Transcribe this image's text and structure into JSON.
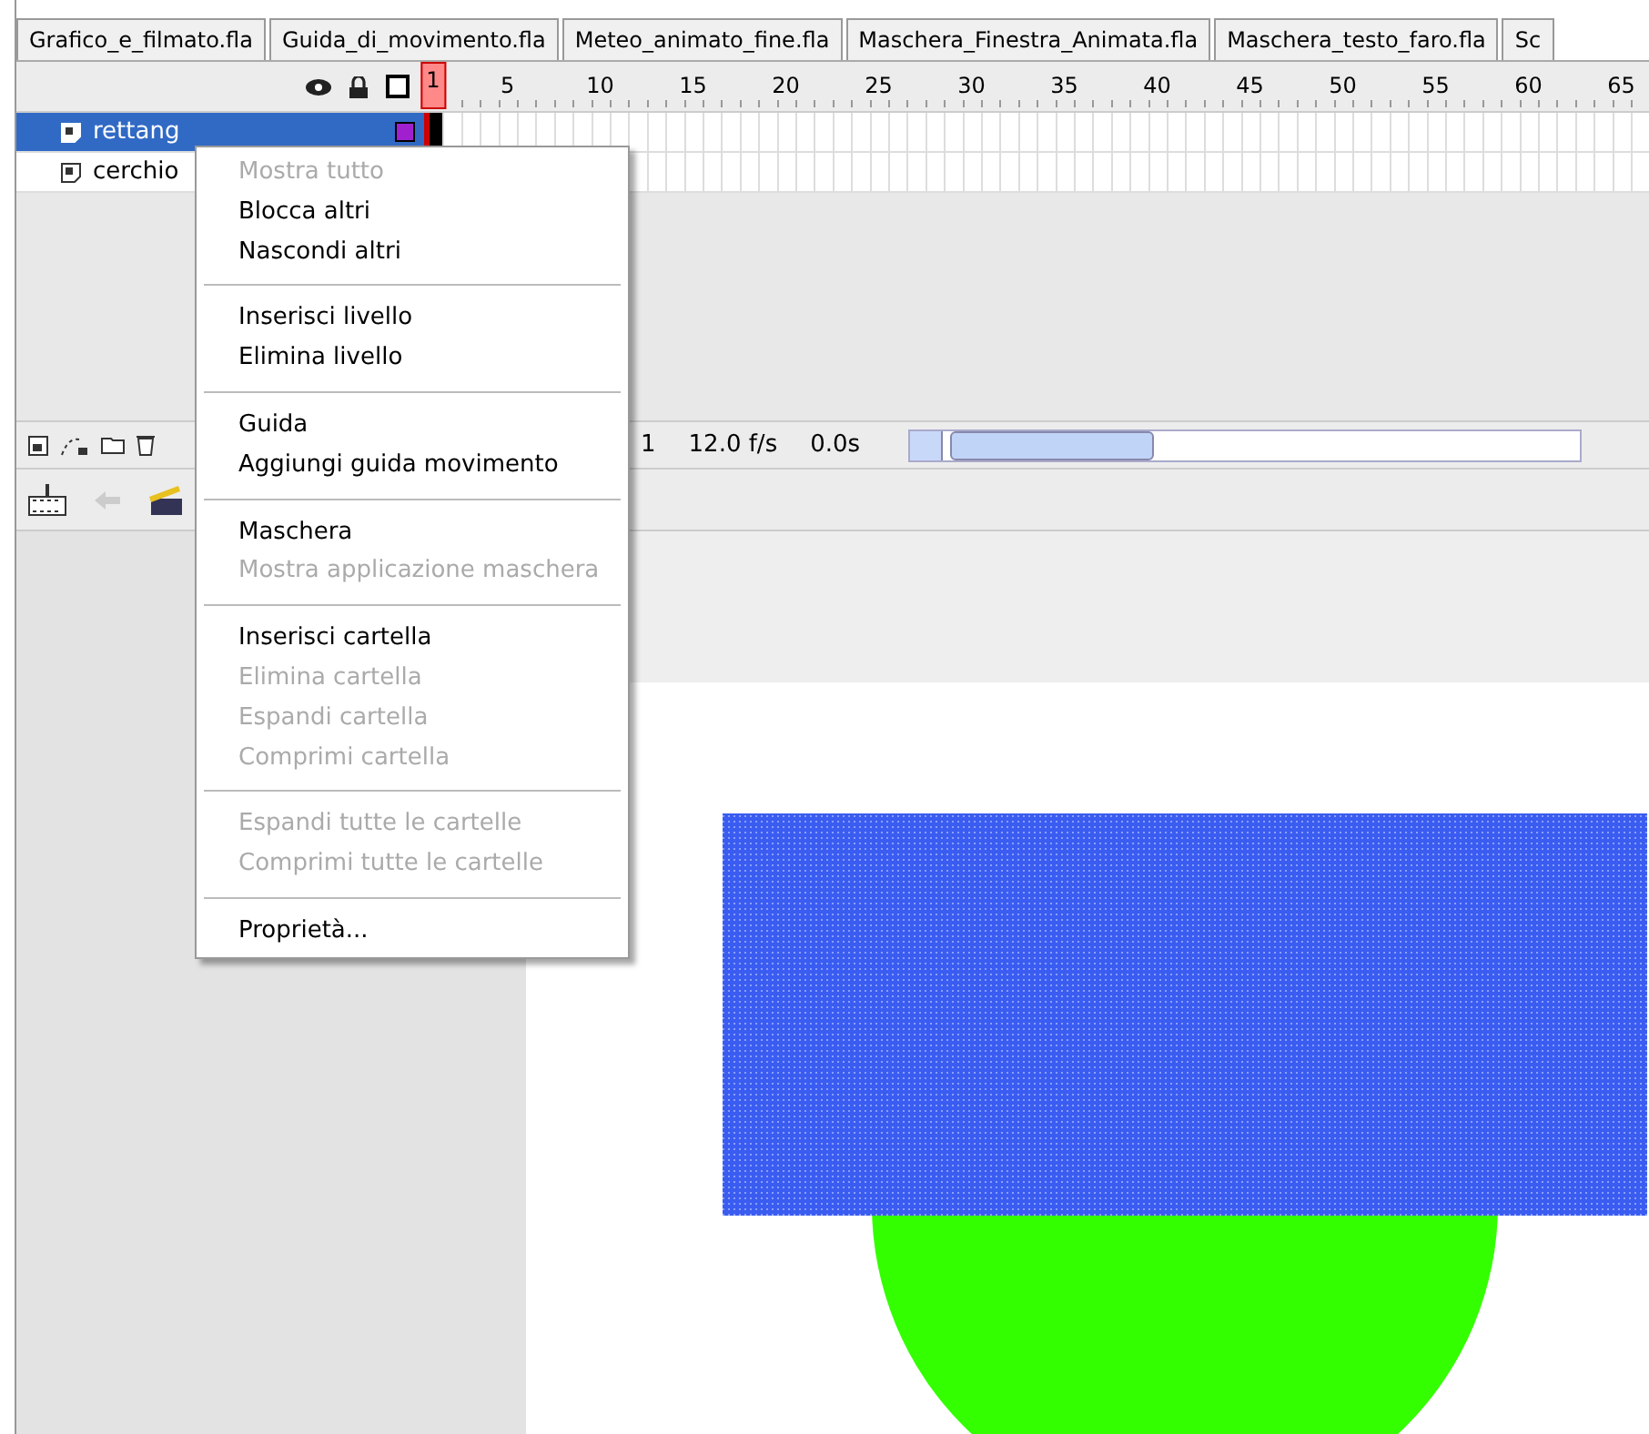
{
  "tabs": [
    {
      "label": "Grafico_e_filmato.fla",
      "selected": false
    },
    {
      "label": "Guida_di_movimento.fla",
      "selected": false
    },
    {
      "label": "Meteo_animato_fine.fla",
      "selected": false
    },
    {
      "label": "Maschera_Finestra_Animata.fla",
      "selected": false
    },
    {
      "label": "Maschera_testo_faro.fla",
      "selected": false
    },
    {
      "label": "Sc",
      "selected": false
    }
  ],
  "timeline": {
    "frames": [
      {
        "label": "1",
        "selected": true
      },
      {
        "label": "5",
        "selected": false
      },
      {
        "label": "10",
        "selected": false
      },
      {
        "label": "15",
        "selected": false
      },
      {
        "label": "20",
        "selected": false
      },
      {
        "label": "25",
        "selected": false
      },
      {
        "label": "30",
        "selected": false
      },
      {
        "label": "35",
        "selected": false
      },
      {
        "label": "40",
        "selected": false
      },
      {
        "label": "45",
        "selected": false
      },
      {
        "label": "50",
        "selected": false
      },
      {
        "label": "55",
        "selected": false
      },
      {
        "label": "60",
        "selected": false
      },
      {
        "label": "65",
        "selected": false
      }
    ],
    "layers": [
      {
        "name": "rettang",
        "selected": true,
        "color": "#a020d0"
      },
      {
        "name": "cerchio",
        "selected": false
      }
    ],
    "status": {
      "frame": "1",
      "rate": "12.0 f/s",
      "time": "0.0s"
    }
  },
  "context_menu": [
    {
      "kind": "item",
      "label": "Mostra tutto",
      "disabled": true
    },
    {
      "kind": "item",
      "label": "Blocca altri",
      "disabled": false
    },
    {
      "kind": "item",
      "label": "Nascondi altri",
      "disabled": false
    },
    {
      "kind": "separator"
    },
    {
      "kind": "item",
      "label": "Inserisci livello",
      "disabled": false
    },
    {
      "kind": "item",
      "label": "Elimina livello",
      "disabled": false
    },
    {
      "kind": "separator"
    },
    {
      "kind": "item",
      "label": "Guida",
      "disabled": false
    },
    {
      "kind": "item",
      "label": "Aggiungi guida movimento",
      "disabled": false
    },
    {
      "kind": "separator"
    },
    {
      "kind": "item",
      "label": "Maschera",
      "disabled": false
    },
    {
      "kind": "item",
      "label": "Mostra applicazione maschera",
      "disabled": true
    },
    {
      "kind": "separator"
    },
    {
      "kind": "item",
      "label": "Inserisci cartella",
      "disabled": false
    },
    {
      "kind": "item",
      "label": "Elimina cartella",
      "disabled": true
    },
    {
      "kind": "item",
      "label": "Espandi cartella",
      "disabled": true
    },
    {
      "kind": "item",
      "label": "Comprimi cartella",
      "disabled": true
    },
    {
      "kind": "separator"
    },
    {
      "kind": "item",
      "label": "Espandi tutte le cartelle",
      "disabled": true
    },
    {
      "kind": "item",
      "label": "Comprimi tutte le cartelle",
      "disabled": true
    },
    {
      "kind": "separator"
    },
    {
      "kind": "item",
      "label": "Proprietà...",
      "disabled": false
    }
  ]
}
